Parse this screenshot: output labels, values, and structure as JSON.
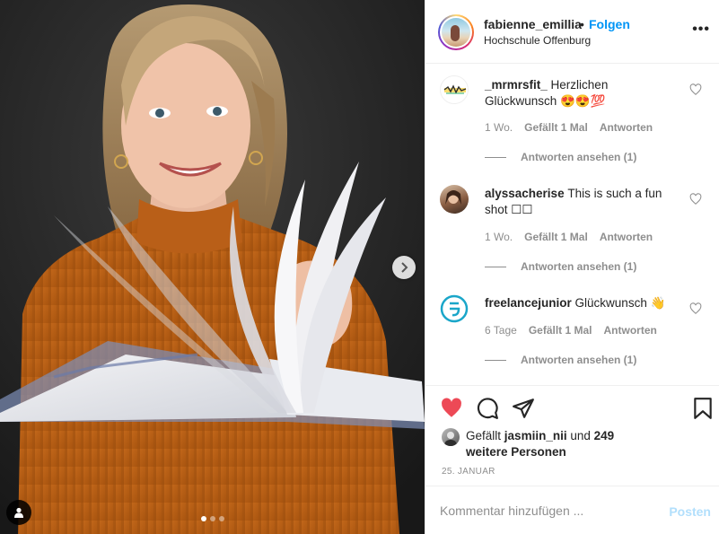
{
  "post": {
    "author": "fabienne_emillia",
    "separator": "•",
    "follow_label": "Folgen",
    "location": "Hochschule Offenburg",
    "more_label": "•••",
    "carousel": {
      "slides": 3,
      "active_index": 0
    }
  },
  "comments": [
    {
      "username": "_mrmrsfit_",
      "text": "Herzlichen Glückwunsch 😍😍💯",
      "age": "1 Wo.",
      "likes": "Gefällt 1 Mal",
      "reply_label": "Antworten",
      "view_replies": "Antworten ansehen (1)"
    },
    {
      "username": "alyssacherise",
      "text": "This is such a fun shot ☐☐",
      "age": "1 Wo.",
      "likes": "Gefällt 1 Mal",
      "reply_label": "Antworten",
      "view_replies": "Antworten ansehen (1)"
    },
    {
      "username": "freelancejunior",
      "text": "Glückwunsch 👋",
      "age": "6 Tage",
      "likes": "Gefällt 1 Mal",
      "reply_label": "Antworten",
      "view_replies": "Antworten ansehen (1)"
    }
  ],
  "likes": {
    "prefix": "Gefällt",
    "liker": "jasmiin_nii",
    "suffix": "und",
    "others": "249 weitere Personen"
  },
  "date": "25. JANUAR",
  "composer": {
    "placeholder": "Kommentar hinzufügen ...",
    "post_label": "Posten"
  },
  "colors": {
    "accent": "#0095f6",
    "like_red": "#ed4956",
    "post_disabled": "#b2dffc",
    "muted": "#8e8e8e"
  }
}
